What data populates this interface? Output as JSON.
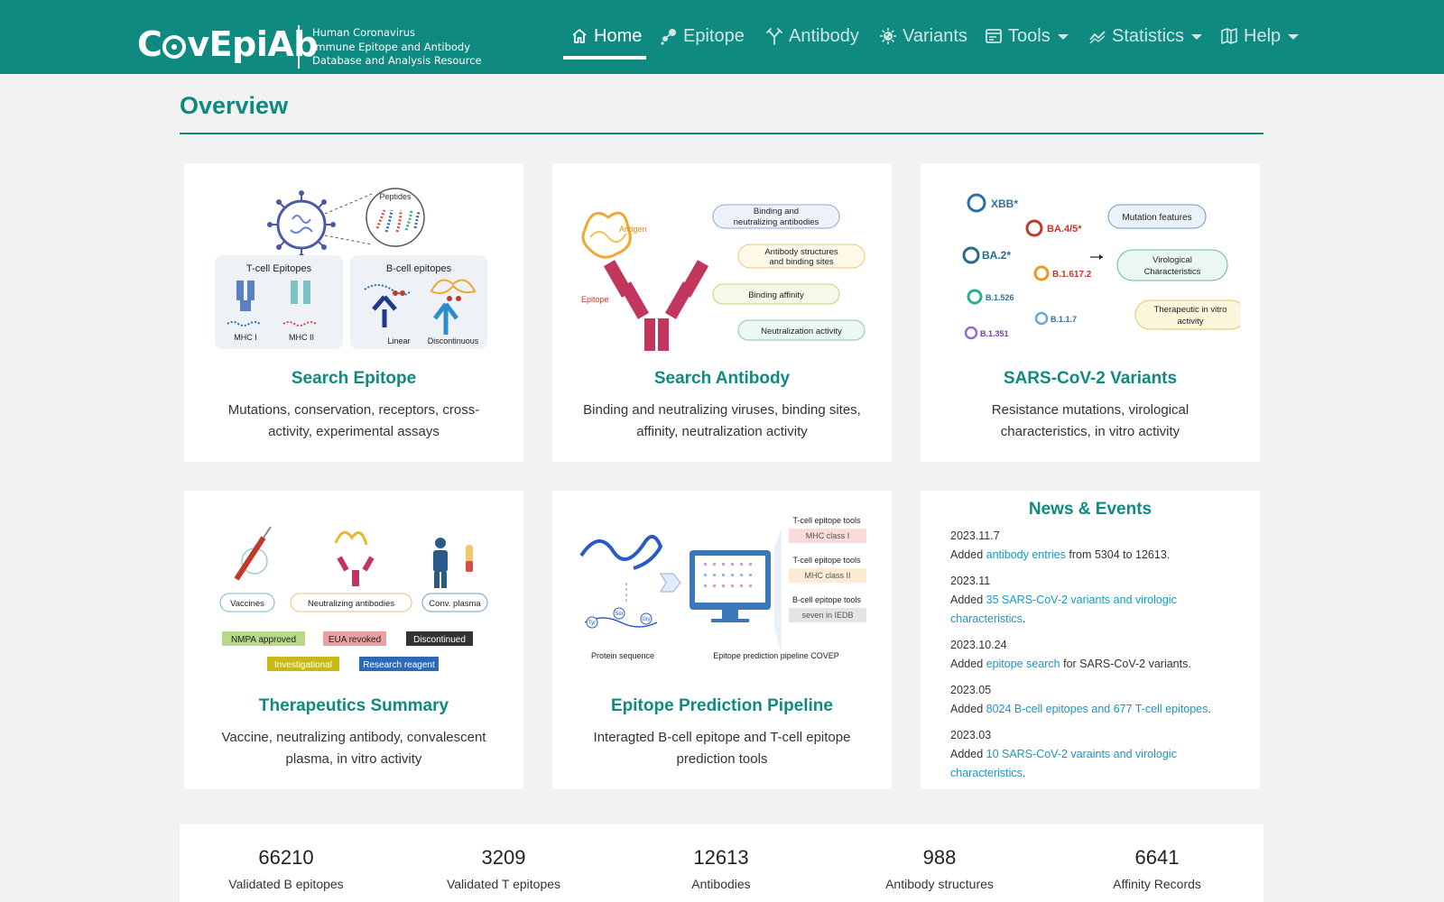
{
  "brand": {
    "logo_text_left": "C",
    "logo_text_right": "vEpiAb",
    "subtitle": [
      "Human Coronavirus",
      "Immune Epitope and Antibody",
      "Database and Analysis Resource"
    ]
  },
  "nav": {
    "items": [
      {
        "label": "Home",
        "icon": "home-icon"
      },
      {
        "label": "Epitope",
        "icon": "epitope-icon"
      },
      {
        "label": "Antibody",
        "icon": "antibody-icon"
      },
      {
        "label": "Variants",
        "icon": "virus-icon"
      },
      {
        "label": "Tools",
        "icon": "tools-icon"
      },
      {
        "label": "Statistics",
        "icon": "chart-line-icon"
      },
      {
        "label": "Help",
        "icon": "book-icon"
      }
    ],
    "active": "Home"
  },
  "overview": {
    "title": "Overview"
  },
  "cards": [
    {
      "title": "Search Epitope",
      "desc": "Mutations, conservation, receptors, cross-activity, experimental assays",
      "fig": {
        "peptides": "Peptides",
        "tcell": "T-cell Epitopes",
        "bcell": "B-cell epitopes",
        "mhc1": "MHC I",
        "mhc2": "MHC II",
        "linear": "Linear",
        "discontinuous": "Discontinuous"
      }
    },
    {
      "title": "Search Antibody",
      "desc": "Binding and neutralizing viruses, binding sites, affinity, neutralization activity",
      "fig": {
        "antigen": "Antigen",
        "epitope": "Epitope",
        "b1a": "Binding and",
        "b1b": "neutralizing antibodies",
        "b2a": "Antibody structures",
        "b2b": "and binding sites",
        "b3": "Binding affinity",
        "b4": "Neutralization activity"
      }
    },
    {
      "title": "SARS-CoV-2 Variants",
      "desc": "Resistance mutations, virological characteristics, in vitro activity",
      "fig": {
        "v1": "XBB*",
        "v2": "BA.4/5*",
        "v3": "BA.2*",
        "v4": "B.1.617.2",
        "v5": "B.1.526",
        "v6": "B.1.1.7",
        "v7": "B.1.351",
        "m1": "Mutation features",
        "m2a": "Virological",
        "m2b": "Characteristics",
        "m3a": "Therapeutic in vitro",
        "m3b": "activity"
      }
    },
    {
      "title": "Therapeutics Summary",
      "desc": "Vaccine, neutralizing antibody, convalescent plasma, in vitro activity",
      "fig": {
        "vaccines": "Vaccines",
        "nab": "Neutralizing antibodies",
        "plasma": "Conv. plasma",
        "nmpa": "NMPA approved",
        "eua": "EUA revoked",
        "disc": "Discontinued",
        "inv": "Investigational",
        "rr": "Research reagent"
      }
    },
    {
      "title": "Epitope Prediction Pipeline",
      "desc": "Interagted B-cell epitope and T-cell epitope prediction tools",
      "fig": {
        "t1": "T-cell epitope tools",
        "t1s": "MHC class I",
        "t2": "T-cell epitope tools",
        "t2s": "MHC class II",
        "b": "B-cell epitope tools",
        "bs": "seven in IEDB",
        "protein": "Protein sequence",
        "pipeline": "Epitope prediction pipeline COVEP",
        "aa1": "Tyr",
        "aa2": "Ser",
        "aa3": "Gly"
      }
    }
  ],
  "news": {
    "title": "News & Events",
    "items": [
      {
        "date": "2023.11.7",
        "pre": "Added ",
        "link": "antibody entries",
        "post": " from 5304 to 12613."
      },
      {
        "date": "2023.11",
        "pre": "Added ",
        "link": "35 SARS-CoV-2 variants and virologic characteristics",
        "post": "."
      },
      {
        "date": "2023.10.24",
        "pre": "Added ",
        "link": "epitope search",
        "post": " for SARS-CoV-2 variants."
      },
      {
        "date": "2023.05",
        "pre": "Added ",
        "link": "8024 B-cell epitopes and 677 T-cell epitopes",
        "post": "."
      },
      {
        "date": "2023.03",
        "pre": "Added ",
        "link": "10 SARS-CoV-2 varaints and virologic characteristics",
        "post": "."
      }
    ]
  },
  "stats": [
    {
      "num": "66210",
      "label": "Validated B epitopes"
    },
    {
      "num": "3209",
      "label": "Validated T epitopes"
    },
    {
      "num": "12613",
      "label": "Antibodies"
    },
    {
      "num": "988",
      "label": "Antibody structures"
    },
    {
      "num": "6641",
      "label": "Affinity Records"
    }
  ],
  "colors": {
    "brand": "#0e8a80",
    "link": "#1a96c4",
    "background": "#f2f2f2"
  }
}
